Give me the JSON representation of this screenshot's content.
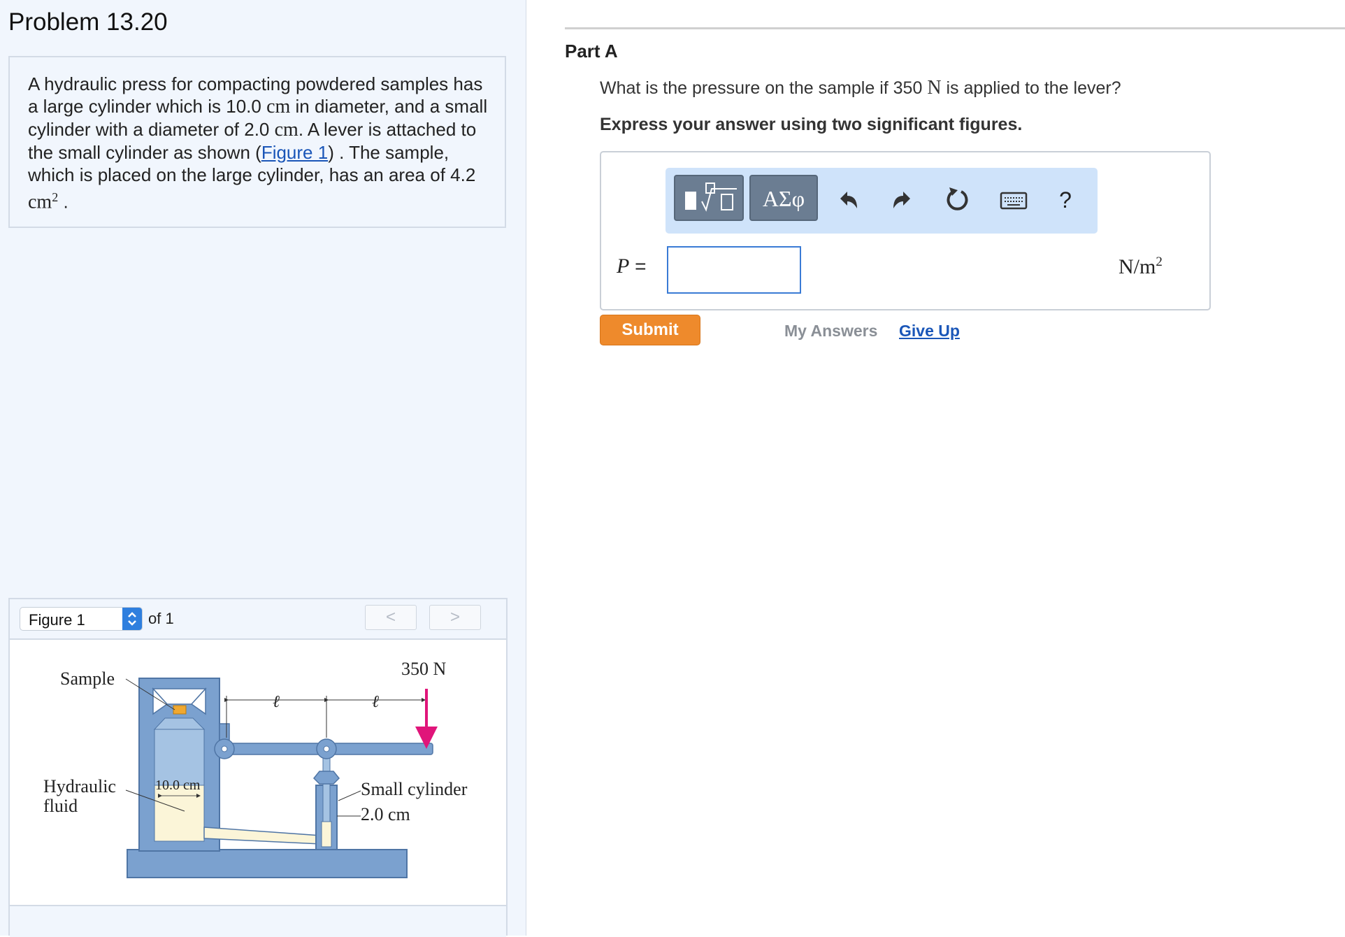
{
  "problem": {
    "title": "Problem 13.20",
    "statement": {
      "t1": "A hydraulic press for compacting powdered samples has a large cylinder which is 10.0 ",
      "u1": "cm",
      "t2": " in diameter, and a small cylinder with a diameter of 2.0 ",
      "u2": "cm",
      "t3": ". A lever is attached to the small cylinder as shown (",
      "link": "Figure 1",
      "t4": ") . The sample, which is placed on the large cylinder, has an area of 4.2 ",
      "u3": "cm",
      "exp": "2",
      "t5": " ."
    }
  },
  "figure": {
    "select_value": "Figure 1",
    "of_text": "of 1",
    "prev": "<",
    "next": ">",
    "labels": {
      "force": "350 N",
      "sample": "Sample",
      "hydraulic1": "Hydraulic",
      "hydraulic2": "fluid",
      "large_diameter": "10.0 cm",
      "small1": "Small cylinder",
      "small2": "2.0 cm",
      "lever1": "ℓ",
      "lever2": "ℓ"
    },
    "colors": {
      "body": "#7ba1cf",
      "fluid": "#fbf5d8",
      "arrow": "#e0157a",
      "sample": "#f0a830"
    }
  },
  "part": {
    "title": "Part A",
    "question_pre": "What is the pressure on the sample if 350 ",
    "question_unit": "N",
    "question_post": " is applied to the lever?",
    "instruction": "Express your answer using two significant figures."
  },
  "toolbar": {
    "greek": "ΑΣφ",
    "templates_icon": "templates-icon",
    "undo_icon": "undo-icon",
    "redo_icon": "redo-icon",
    "reset_icon": "reset-icon",
    "keyboard_icon": "keyboard-icon",
    "help": "?"
  },
  "answer": {
    "label": "P =",
    "value": "",
    "unit_base": "N/m",
    "unit_exp": "2"
  },
  "actions": {
    "submit": "Submit",
    "my_answers": "My Answers",
    "give_up": "Give Up"
  }
}
